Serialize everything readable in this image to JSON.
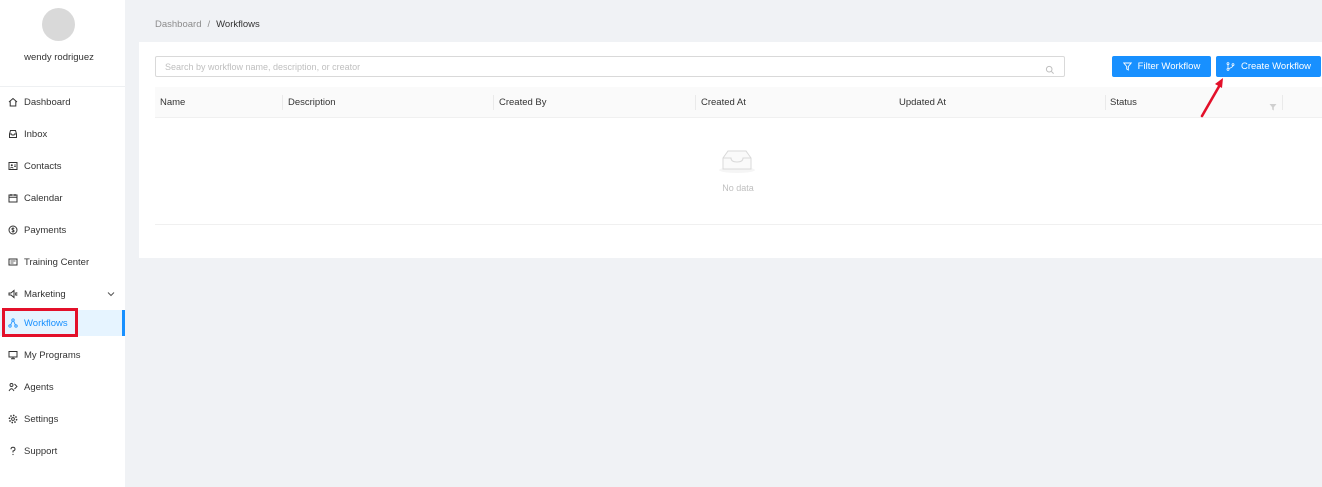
{
  "user": {
    "name": "wendy rodriguez"
  },
  "sidebar": {
    "items": [
      {
        "label": "Dashboard",
        "icon": "home-icon"
      },
      {
        "label": "Inbox",
        "icon": "inbox-icon"
      },
      {
        "label": "Contacts",
        "icon": "contacts-icon"
      },
      {
        "label": "Calendar",
        "icon": "calendar-icon"
      },
      {
        "label": "Payments",
        "icon": "dollar-circle-icon"
      },
      {
        "label": "Training Center",
        "icon": "training-icon"
      },
      {
        "label": "Marketing",
        "icon": "megaphone-icon",
        "expandable": true
      },
      {
        "label": "Workflows",
        "icon": "workflow-icon",
        "active": true
      },
      {
        "label": "My Programs",
        "icon": "monitor-icon"
      },
      {
        "label": "Agents",
        "icon": "agents-icon"
      },
      {
        "label": "Settings",
        "icon": "gear-icon"
      },
      {
        "label": "Support",
        "icon": "question-icon"
      }
    ]
  },
  "breadcrumb": {
    "parent": "Dashboard",
    "separator": "/",
    "current": "Workflows"
  },
  "search": {
    "placeholder": "Search by workflow name, description, or creator",
    "value": ""
  },
  "toolbar": {
    "filter_label": "Filter Workflow",
    "create_label": "Create Workflow"
  },
  "table": {
    "columns": [
      "Name",
      "Description",
      "Created By",
      "Created At",
      "Updated At",
      "Status"
    ],
    "rows": [],
    "empty_text": "No data"
  },
  "colors": {
    "accent": "#1890ff",
    "highlight": "#e3102a",
    "active_bg": "#e6f4ff"
  }
}
